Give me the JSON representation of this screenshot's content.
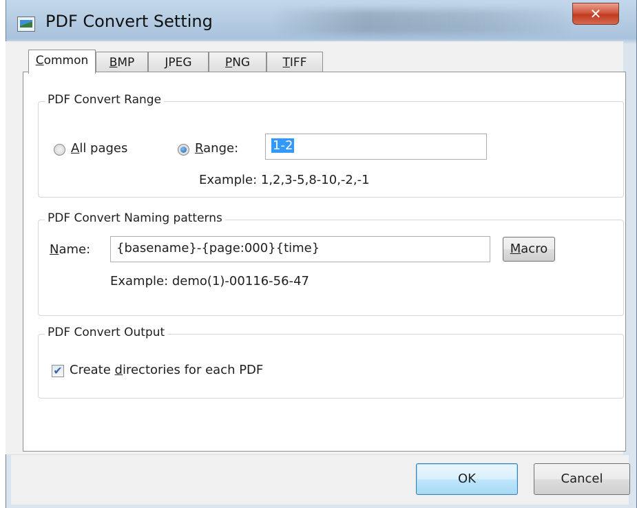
{
  "window": {
    "title": "PDF Convert Setting",
    "close_glyph": "✕",
    "title_icon": "image-icon"
  },
  "tabs": [
    {
      "label": "Common",
      "mnemonic": "C",
      "rest": "ommon",
      "active": true
    },
    {
      "label": "BMP",
      "mnemonic": "B",
      "rest": "MP",
      "active": false
    },
    {
      "label": "JPEG",
      "mnemonic": "J",
      "rest": "PEG",
      "active": false
    },
    {
      "label": "PNG",
      "mnemonic": "P",
      "rest": "NG",
      "active": false
    },
    {
      "label": "TIFF",
      "mnemonic": "T",
      "rest": "IFF",
      "active": false
    }
  ],
  "range_group": {
    "legend": "PDF Convert Range",
    "all_pages": {
      "mnemonic": "A",
      "rest": "ll pages",
      "selected": false
    },
    "range": {
      "mnemonic": "R",
      "rest": "ange:",
      "selected": true
    },
    "range_value": "1-2",
    "example": "Example: 1,2,3-5,8-10,-2,-1"
  },
  "naming_group": {
    "legend": "PDF Convert Naming patterns",
    "name_label": {
      "mnemonic": "N",
      "rest": "ame:"
    },
    "name_value": "{basename}-{page:000}{time}",
    "macro_button": {
      "mnemonic": "M",
      "rest": "acro"
    },
    "example": "Example:  demo(1)-00116-56-47"
  },
  "output_group": {
    "legend": "PDF Convert Output",
    "create_dirs": {
      "pre": "Create ",
      "mnemonic": "d",
      "rest": "irectories for each PDF",
      "checked": true
    },
    "check_glyph": "✔"
  },
  "buttons": {
    "ok": "OK",
    "cancel": "Cancel"
  },
  "colors": {
    "close_button": "#c03b22",
    "selection": "#3399ff",
    "default_button_border": "#3c7fb1"
  }
}
